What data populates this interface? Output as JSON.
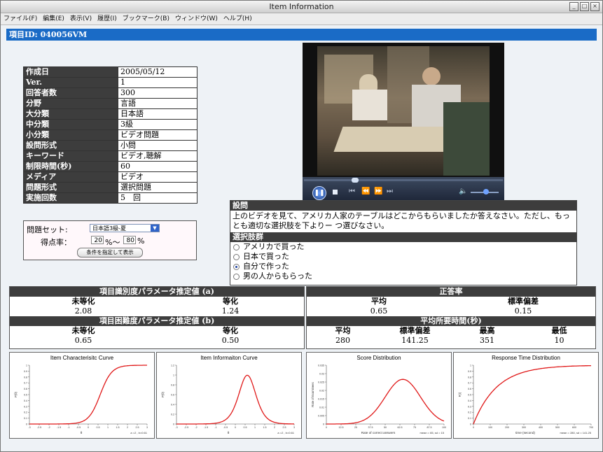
{
  "window": {
    "title": "Item Information",
    "buttons": [
      "_",
      "□",
      "×"
    ]
  },
  "menu": [
    "ファイル(F)",
    "編集(E)",
    "表示(V)",
    "履歴(I)",
    "ブックマーク(B)",
    "ウィンドウ(W)",
    "ヘルプ(H)"
  ],
  "item_id_label": "項目ID: 040056VM",
  "info": [
    {
      "k": "作成日",
      "v": "2005/05/12"
    },
    {
      "k": "Ver.",
      "v": "1"
    },
    {
      "k": "回答者数",
      "v": "300"
    },
    {
      "k": "分野",
      "v": "言語"
    },
    {
      "k": "大分類",
      "v": "日本語"
    },
    {
      "k": "中分類",
      "v": "3級"
    },
    {
      "k": "小分類",
      "v": "ビデオ問題"
    },
    {
      "k": "設問形式",
      "v": "小問"
    },
    {
      "k": "キーワード",
      "v": "ビデオ,聴解"
    },
    {
      "k": "制限時間(秒)",
      "v": "60"
    },
    {
      "k": "メディア",
      "v": "ビデオ"
    },
    {
      "k": "問題形式",
      "v": "選択問題"
    },
    {
      "k": "実施回数",
      "v": "5　回"
    }
  ],
  "filter": {
    "set_label": "問題セット:",
    "set_value": "日本語3級-夏",
    "score_label": "得点率：",
    "score_from": "20",
    "score_to": "80",
    "sep": "%〜",
    "pct": "%",
    "button": "条件を指定して表示"
  },
  "question": {
    "heading": "設問",
    "text": "上のビデオを見て、アメリカ人家のテーブルはどこからもらいましたか答えなさい。ただし、もっとも適切な選択肢を下よりー つ選びなさい。",
    "options_heading": "選択肢群",
    "options": [
      "アメリカで買った",
      "日本で買った",
      "自分で作った",
      "男の人からもらった"
    ],
    "selected_index": 2
  },
  "discrimination": {
    "title": "項目識別度パラメータ推定値 (a)",
    "col1": "未等化",
    "col2": "等化",
    "v1": "2.08",
    "v2": "1.24"
  },
  "difficulty": {
    "title": "項目困難度パラメータ推定値 (b)",
    "col1": "未等化",
    "col2": "等化",
    "v1": "0.65",
    "v2": "0.50"
  },
  "correct_rate": {
    "title": "正答率",
    "col1": "平均",
    "col2": "標準偏差",
    "v1": "0.65",
    "v2": "0.15"
  },
  "response_time": {
    "title": "平均所要時間(秒)",
    "cols": [
      "平均",
      "標準偏差",
      "最高",
      "最低"
    ],
    "vals": [
      "280",
      "141.25",
      "351",
      "10"
    ]
  },
  "chart_data": [
    {
      "type": "line",
      "title": "Item Characterisitc Curve",
      "ylabel": "P(θ)",
      "xlabel": "θ",
      "note": "a =2 , b=0.61",
      "curve": "logistic",
      "a": 2,
      "b": 0.61,
      "ylim": [
        0,
        1
      ],
      "yticks": [
        "0",
        "0.1",
        "0.2",
        "0.3",
        "0.4",
        "0.5",
        "0.6",
        "0.7",
        "0.8",
        "0.9",
        "1"
      ],
      "xticks": [
        "-3",
        "-2.5",
        "-2",
        "-1.5",
        "-1",
        "-0.5",
        "0",
        "0.5",
        "1",
        "1.5",
        "2",
        "2.5",
        "3"
      ]
    },
    {
      "type": "line",
      "title": "Item Informaiton Curve",
      "ylabel": "P(θ)",
      "xlabel": "θ",
      "note": "a =2 , b=0.61",
      "curve": "information",
      "a": 2,
      "b": 0.61,
      "ylim": [
        0,
        1.2
      ],
      "yticks": [
        "0",
        "0.2",
        "0.4",
        "0.6",
        "0.8",
        "1",
        "1.2"
      ],
      "xticks": [
        "-3",
        "-2.5",
        "-2",
        "-1.5",
        "-1",
        "-0.5",
        "0",
        "0.5",
        "1",
        "1.5",
        "2",
        "2.5",
        "3"
      ]
    },
    {
      "type": "line",
      "title": "Score Distribution",
      "ylabel": "Rate of Examinees",
      "xlabel": "Rate of correct answers",
      "note": "mean = 65, sd = 15",
      "curve": "normal",
      "mean": 65,
      "sd": 15,
      "ylim": [
        0,
        0.035
      ],
      "yticks": [
        "0",
        "0.005",
        "0.01",
        "0.015",
        "0.02",
        "0.025",
        "0.03",
        "0.035"
      ],
      "xticks": [
        "0",
        "12.5",
        "25",
        "37.5",
        "50",
        "62.5",
        "75",
        "87.5",
        "100"
      ]
    },
    {
      "type": "line",
      "title": "Response Time Distribution",
      "ylabel": "F(t)",
      "xlabel": "time (second)",
      "note": "mean = 280, sd = 141.25",
      "curve": "cdf_exp",
      "mean": 280,
      "ylim": [
        0,
        1
      ],
      "yticks": [
        "0",
        "0.1",
        "0.2",
        "0.3",
        "0.4",
        "0.5",
        "0.6",
        "0.7",
        "0.8",
        "0.9",
        "1"
      ],
      "xticks": [
        "0",
        "100",
        "200",
        "300",
        "400",
        "500",
        "600",
        "700"
      ]
    }
  ]
}
